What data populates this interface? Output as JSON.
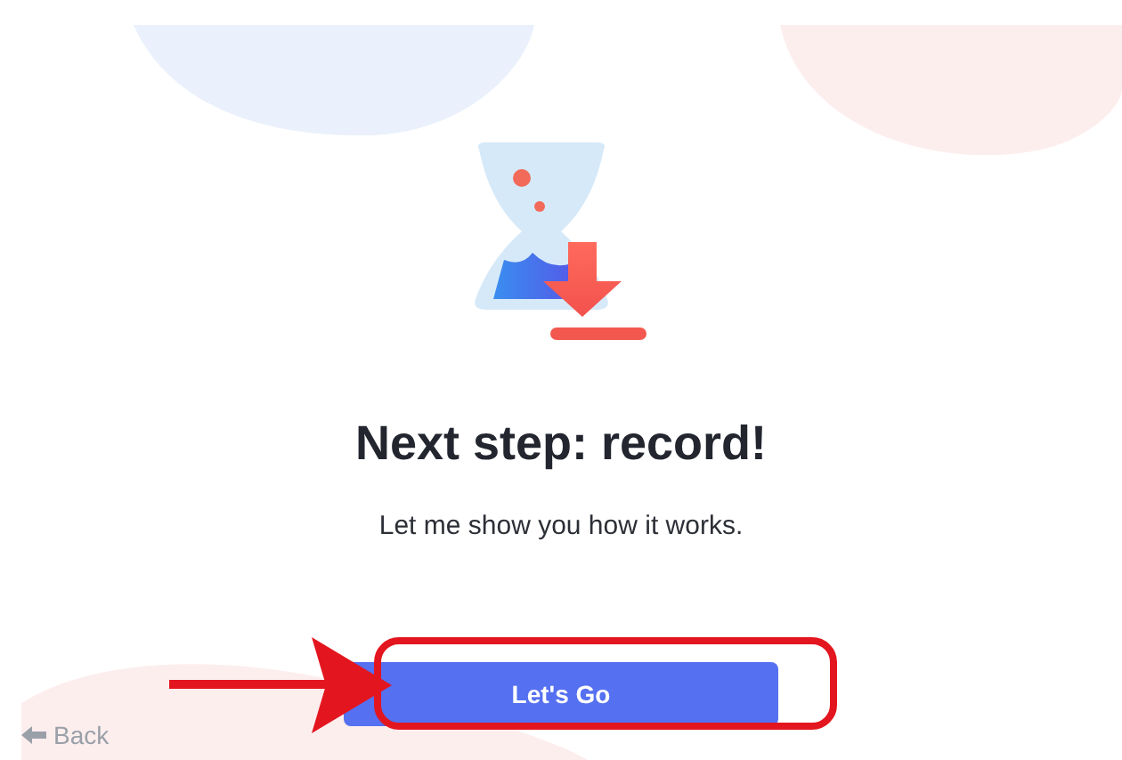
{
  "heading": "Next step: record!",
  "subtitle": "Let me show you how it works.",
  "primary_button": {
    "label": "Let's Go"
  },
  "back_link": {
    "label": "Back"
  }
}
